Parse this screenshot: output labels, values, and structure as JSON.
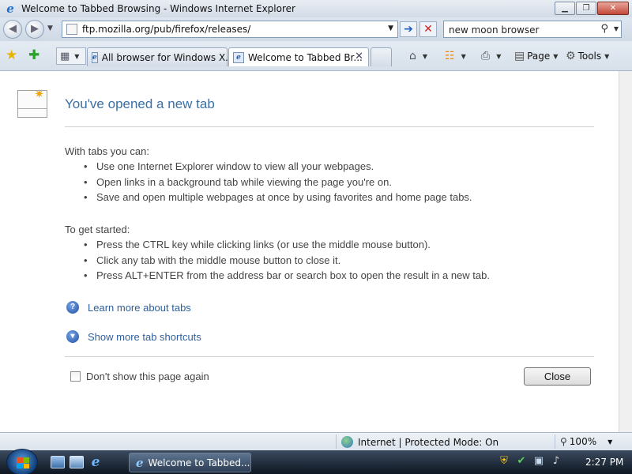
{
  "window": {
    "title": "Welcome to Tabbed Browsing - Windows Internet Explorer",
    "logo_icon": "ie-logo-icon",
    "controls": {
      "minimize": "▁",
      "maximize": "❐",
      "close": "✕"
    }
  },
  "address_bar": {
    "back_glyph": "◀",
    "forward_glyph": "▶",
    "recent_glyph": "▼",
    "url": "ftp.mozilla.org/pub/firefox/releases/",
    "dropdown_glyph": "▼",
    "go_glyph": "➔",
    "stop_glyph": "✕"
  },
  "search": {
    "value": "new moon browser",
    "icon_glyph": "⚲",
    "dropdown_glyph": "▼"
  },
  "toolbar": {
    "favorites_glyph": "★",
    "add_favorites_glyph": "✚",
    "quick_tabs_glyph": "▦",
    "quick_tabs_drop": "▼",
    "tabs": [
      {
        "label": "All browser for Windows X...",
        "active": false
      },
      {
        "label": "Welcome to Tabbed Br...",
        "active": true,
        "close_glyph": "✕"
      },
      {
        "label": "",
        "active": false
      }
    ],
    "home_glyph": "⌂",
    "feeds_glyph": "☷",
    "print_glyph": "⎙",
    "page_glyph": "▤",
    "page_label": "Page",
    "tools_glyph": "⚙",
    "tools_label": "Tools",
    "drop_glyph": "▼"
  },
  "content": {
    "title": "You've opened a new tab",
    "tabs_heading": "With tabs you can:",
    "tabs_bullets": [
      "Use one Internet Explorer window to view all your webpages.",
      "Open links in a background tab while viewing the page you're on.",
      "Save and open multiple webpages at once by using favorites and home page tabs."
    ],
    "start_heading": "To get started:",
    "start_bullets": [
      "Press the CTRL key while clicking links (or use the middle mouse button).",
      "Click any tab with the middle mouse button to close it.",
      "Press ALT+ENTER from the address bar or search box to open the result in a new tab."
    ],
    "learn_more_glyph": "?",
    "learn_more_label": "Learn more about tabs",
    "show_more_glyph": "▾",
    "show_more_label": "Show more tab shortcuts",
    "dont_show_label": "Don't show this page again",
    "close_button_label": "Close"
  },
  "status_bar": {
    "zone_text": "Internet | Protected Mode: On",
    "zoom_glyph": "⚲",
    "zoom_level": "100%",
    "zoom_drop": "▼"
  },
  "taskbar": {
    "task_label": "Welcome to Tabbed...",
    "tray_glyphs": {
      "shield": "⛨",
      "check": "✔",
      "network": "▣",
      "volume": "♪"
    },
    "clock": "2:27 PM"
  },
  "colors": {
    "link_blue": "#2f5f9a",
    "title_blue": "#3b6fa5",
    "taskbar_dark": "#0e1722"
  }
}
